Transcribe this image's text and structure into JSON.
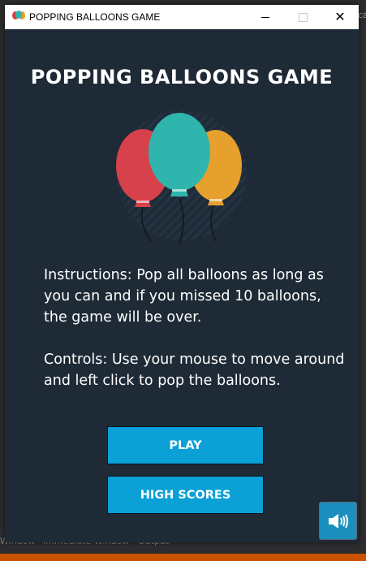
{
  "window": {
    "title": "POPPING BALLOONS GAME"
  },
  "background": {
    "right_text": "cat",
    "bottom_tabs": [
      "Window",
      "Immediate Window",
      "Output"
    ]
  },
  "game": {
    "title": "POPPING BALLOONS GAME",
    "instructions": "Instructions: Pop all balloons as long as you can and if you missed 10 balloons, the game will be over.",
    "controls": "Controls: Use your mouse to move around and left click to pop the balloons.",
    "play_label": "PLAY",
    "high_scores_label": "HIGH SCORES"
  },
  "colors": {
    "background": "#1e2a36",
    "button": "#0ba0d6",
    "balloon_red": "#d6414b",
    "balloon_teal": "#2fb5ad",
    "balloon_orange": "#e5a02d"
  },
  "icons": {
    "app": "balloons-icon",
    "sound": "speaker-icon"
  }
}
